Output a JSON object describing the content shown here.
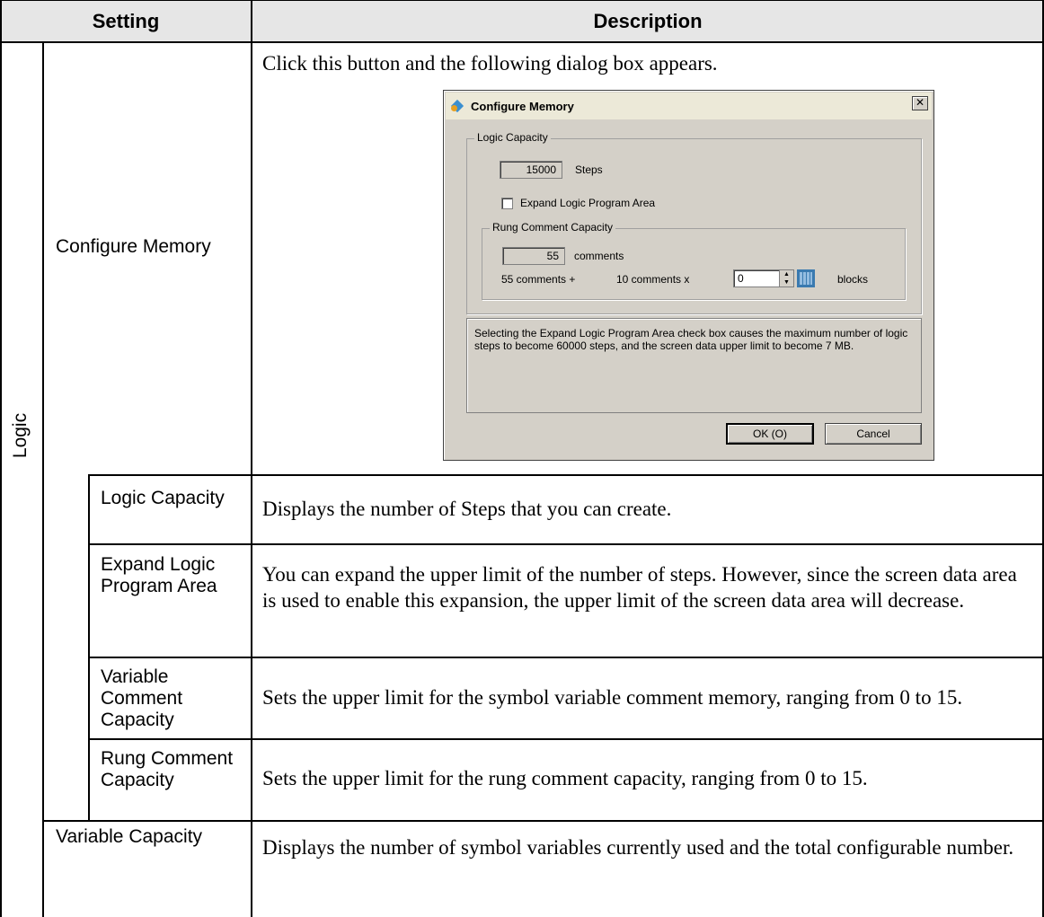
{
  "header": {
    "setting": "Setting",
    "description": "Description"
  },
  "logic_label": "Logic",
  "rows": {
    "configure_memory": {
      "label": "Configure Memory",
      "description": "Click this button and the following dialog box appears."
    },
    "logic_capacity": {
      "label": "Logic Capacity",
      "description": "Displays the number of Steps that you can create."
    },
    "expand_logic": {
      "label": "Expand Logic Program Area",
      "description": "You can expand the upper limit of the number of steps. However, since the screen data area is used to enable this expansion, the upper limit of the screen data area will decrease."
    },
    "variable_comment": {
      "label": "Variable Comment Capacity",
      "description": "Sets the upper limit for the symbol variable comment memory, ranging from 0 to 15."
    },
    "rung_comment": {
      "label": "Rung Comment Capacity",
      "description": "Sets the upper limit for the rung comment capacity, ranging from 0 to 15."
    },
    "variable_capacity": {
      "label": "Variable Capacity",
      "description": "Displays the number of symbol variables currently used and the total configurable number."
    }
  },
  "dialog": {
    "title": "Configure Memory",
    "close_glyph": "✕",
    "logic_group": "Logic Capacity",
    "steps_value": "15000",
    "steps_unit": "Steps",
    "expand_checkbox_label": "Expand Logic Program Area",
    "expand_checked": false,
    "rung_group": "Rung Comment Capacity",
    "comments_value": "55",
    "comments_unit": "comments",
    "calc_base": "55  comments +",
    "calc_per": "10  comments x",
    "blocks_value": "0",
    "blocks_unit": "blocks",
    "info_text": "Selecting the Expand Logic Program Area check box causes the maximum number of logic steps to become 60000 steps, and the screen data upper limit to become 7 MB.",
    "ok_label": "OK (O)",
    "cancel_label": "Cancel"
  }
}
